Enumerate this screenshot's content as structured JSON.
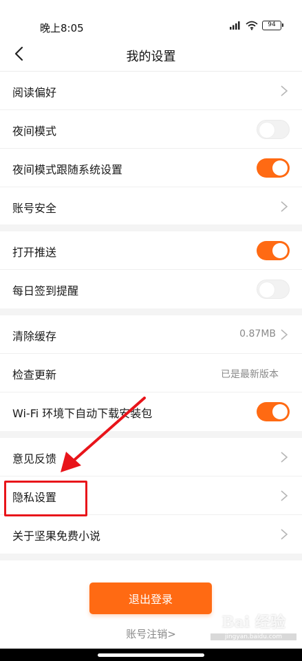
{
  "status_bar": {
    "time": "晚上8:05",
    "battery": "94",
    "icons": [
      "signal-icon",
      "wifi-icon",
      "battery-icon"
    ]
  },
  "nav": {
    "title": "我的设置",
    "back_icon": "back-arrow-icon"
  },
  "groups": [
    {
      "rows": [
        {
          "label": "阅读偏好",
          "type": "chevron"
        },
        {
          "label": "夜间模式",
          "type": "toggle",
          "on": false
        },
        {
          "label": "夜间模式跟随系统设置",
          "type": "toggle",
          "on": true
        },
        {
          "label": "账号安全",
          "type": "chevron"
        }
      ]
    },
    {
      "rows": [
        {
          "label": "打开推送",
          "type": "toggle",
          "on": true
        },
        {
          "label": "每日签到提醒",
          "type": "toggle",
          "on": false
        }
      ]
    },
    {
      "rows": [
        {
          "label": "清除缓存",
          "type": "value_chevron",
          "value": "0.87MB"
        },
        {
          "label": "检查更新",
          "type": "value",
          "value": "已是最新版本"
        },
        {
          "label": "Wi-Fi 环境下自动下载安装包",
          "type": "toggle",
          "on": true
        }
      ]
    },
    {
      "rows": [
        {
          "label": "意见反馈",
          "type": "chevron"
        },
        {
          "label": "隐私设置",
          "type": "chevron"
        },
        {
          "label": "关于坚果免费小说",
          "type": "chevron"
        }
      ]
    }
  ],
  "footer": {
    "logout_label": "退出登录",
    "cancel_account_label": "账号注销>"
  },
  "colors": {
    "accent": "#ff6a13",
    "annotation": "#e8141a",
    "section_gap": "#f4f4f4"
  },
  "watermark": {
    "logo": "Bai 经验",
    "url": "jingyan.baidu.com"
  }
}
